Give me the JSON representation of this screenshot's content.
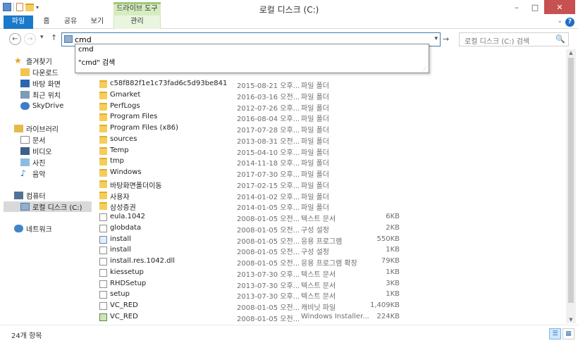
{
  "window": {
    "title": "로컬 디스크 (C:)",
    "context_tab_title": "드라이브 도구",
    "buttons": {
      "minimize": "–",
      "maximize": "□",
      "close": "✕"
    }
  },
  "ribbon": {
    "tabs": [
      {
        "label": "파일"
      },
      {
        "label": "홈"
      },
      {
        "label": "공유"
      },
      {
        "label": "보기"
      },
      {
        "label": "관리"
      }
    ],
    "help": "?"
  },
  "address": {
    "value": "cmd",
    "search_placeholder": "로컬 디스크 (C:) 검색"
  },
  "autocomplete": [
    "cmd",
    "\"cmd\" 검색"
  ],
  "sidebar": {
    "items": [
      {
        "label": "즐겨찾기",
        "icon": "star-icon"
      },
      {
        "label": "다운로드",
        "icon": "download-icon"
      },
      {
        "label": "바탕 화면",
        "icon": "desktop-icon"
      },
      {
        "label": "최근 위치",
        "icon": "recent-icon"
      },
      {
        "label": "SkyDrive",
        "icon": "cloud-icon"
      },
      {
        "label": "라이브러리",
        "icon": "library-icon"
      },
      {
        "label": "문서",
        "icon": "document-icon"
      },
      {
        "label": "비디오",
        "icon": "video-icon"
      },
      {
        "label": "사진",
        "icon": "picture-icon"
      },
      {
        "label": "음악",
        "icon": "music-icon"
      },
      {
        "label": "컴퓨터",
        "icon": "computer-icon"
      },
      {
        "label": "로컬 디스크 (C:)",
        "icon": "drive-icon"
      },
      {
        "label": "네트워크",
        "icon": "network-icon"
      }
    ]
  },
  "files": [
    {
      "name": "c58f882f1e1c73fad6c5d93be841",
      "date": "2015-08-21 오후...",
      "type": "파일 폴더",
      "size": "",
      "kind": "folder"
    },
    {
      "name": "Gmarket",
      "date": "2016-03-16 오전...",
      "type": "파일 폴더",
      "size": "",
      "kind": "folder"
    },
    {
      "name": "PerfLogs",
      "date": "2012-07-26 오후...",
      "type": "파일 폴더",
      "size": "",
      "kind": "folder"
    },
    {
      "name": "Program Files",
      "date": "2016-08-04 오후...",
      "type": "파일 폴더",
      "size": "",
      "kind": "folder"
    },
    {
      "name": "Program Files (x86)",
      "date": "2017-07-28 오후...",
      "type": "파일 폴더",
      "size": "",
      "kind": "folder"
    },
    {
      "name": "sources",
      "date": "2013-08-31 오전...",
      "type": "파일 폴더",
      "size": "",
      "kind": "folder"
    },
    {
      "name": "Temp",
      "date": "2015-04-10 오후...",
      "type": "파일 폴더",
      "size": "",
      "kind": "folder"
    },
    {
      "name": "tmp",
      "date": "2014-11-18 오후...",
      "type": "파일 폴더",
      "size": "",
      "kind": "folder"
    },
    {
      "name": "Windows",
      "date": "2017-07-30 오후...",
      "type": "파일 폴더",
      "size": "",
      "kind": "folder"
    },
    {
      "name": "바탕화면폴더이동",
      "date": "2017-02-15 오후...",
      "type": "파일 폴더",
      "size": "",
      "kind": "folder"
    },
    {
      "name": "사용자",
      "date": "2014-01-02 오후...",
      "type": "파일 폴더",
      "size": "",
      "kind": "folder"
    },
    {
      "name": "삼성증권",
      "date": "2014-01-05 오후...",
      "type": "파일 폴더",
      "size": "",
      "kind": "folder"
    },
    {
      "name": "eula.1042",
      "date": "2008-01-05 오전...",
      "type": "텍스트 문서",
      "size": "6KB",
      "kind": "file"
    },
    {
      "name": "globdata",
      "date": "2008-01-05 오전...",
      "type": "구성 설정",
      "size": "2KB",
      "kind": "file"
    },
    {
      "name": "install",
      "date": "2008-01-05 오전...",
      "type": "응용 프로그램",
      "size": "550KB",
      "kind": "exe"
    },
    {
      "name": "install",
      "date": "2008-01-05 오전...",
      "type": "구성 설정",
      "size": "1KB",
      "kind": "file"
    },
    {
      "name": "install.res.1042.dll",
      "date": "2008-01-05 오전...",
      "type": "응용 프로그램 확장",
      "size": "79KB",
      "kind": "file"
    },
    {
      "name": "kiessetup",
      "date": "2013-07-30 오후...",
      "type": "텍스트 문서",
      "size": "1KB",
      "kind": "file"
    },
    {
      "name": "RHDSetup",
      "date": "2013-07-30 오후...",
      "type": "텍스트 문서",
      "size": "3KB",
      "kind": "file"
    },
    {
      "name": "setup",
      "date": "2013-07-30 오후...",
      "type": "텍스트 문서",
      "size": "1KB",
      "kind": "file"
    },
    {
      "name": "VC_RED",
      "date": "2008-01-05 오전...",
      "type": "캐비닛 파일",
      "size": "1,409KB",
      "kind": "file"
    },
    {
      "name": "VC_RED",
      "date": "2008-01-05 오전...",
      "type": "Windows Installer...",
      "size": "224KB",
      "kind": "installer"
    }
  ],
  "status": {
    "count": "24개 항목"
  },
  "icons": {
    "back": "←",
    "forward": "→",
    "up": "↑",
    "dropdown": "▾",
    "go": "→",
    "search": "🔍"
  }
}
